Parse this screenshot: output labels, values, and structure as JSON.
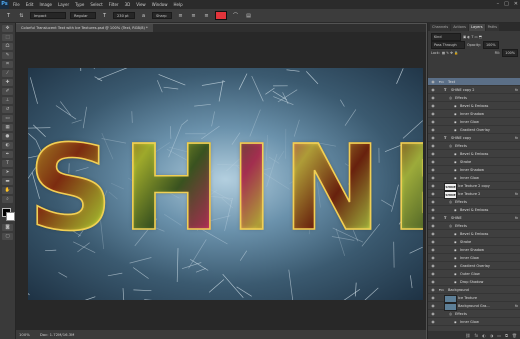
{
  "app": {
    "logo": "Ps"
  },
  "menu": [
    "File",
    "Edit",
    "Image",
    "Layer",
    "Type",
    "Select",
    "Filter",
    "3D",
    "View",
    "Window",
    "Help"
  ],
  "window_controls": [
    "–",
    "□",
    "✕"
  ],
  "options": {
    "font_family": "Impact",
    "font_style": "Regular",
    "font_size": "230 pt",
    "antialias": "Sharp",
    "text_color": "#e2343b"
  },
  "document": {
    "tab_title": "Colorful Translucent Text with Ice Textures.psd @ 100% (Text, RGB/8) *",
    "headline": "SHINE"
  },
  "status": {
    "zoom": "100%",
    "doc_size": "Doc: 1.72M/16.3M"
  },
  "panel": {
    "tabs": [
      "Channels",
      "Actions",
      "Layers",
      "Paths"
    ],
    "active_tab": "Layers",
    "kind_label": "Kind",
    "blend_mode": "Pass Through",
    "opacity_label": "Opacity:",
    "opacity_value": "100%",
    "lock_label": "Lock:",
    "fill_label": "Fill:",
    "fill_value": "100%"
  },
  "layers": [
    {
      "name": "Text",
      "type": "group",
      "indent": 0,
      "selected": true
    },
    {
      "name": "SHINE copy 2",
      "type": "text",
      "indent": 1,
      "fx": true
    },
    {
      "name": "Effects",
      "type": "effects",
      "indent": 2
    },
    {
      "name": "Bevel & Emboss",
      "type": "effect",
      "indent": 3
    },
    {
      "name": "Inner Shadow",
      "type": "effect",
      "indent": 3
    },
    {
      "name": "Inner Glow",
      "type": "effect",
      "indent": 3
    },
    {
      "name": "Gradient Overlay",
      "type": "effect",
      "indent": 3
    },
    {
      "name": "SHINE copy",
      "type": "text",
      "indent": 1,
      "fx": true
    },
    {
      "name": "Effects",
      "type": "effects",
      "indent": 2
    },
    {
      "name": "Bevel & Emboss",
      "type": "effect",
      "indent": 3
    },
    {
      "name": "Stroke",
      "type": "effect",
      "indent": 3
    },
    {
      "name": "Inner Shadow",
      "type": "effect",
      "indent": 3
    },
    {
      "name": "Inner Glow",
      "type": "effect",
      "indent": 3
    },
    {
      "name": "Ice Texture 2 copy",
      "type": "image",
      "indent": 1,
      "thumb": "SHINE"
    },
    {
      "name": "Ice Texture 2",
      "type": "image",
      "indent": 1,
      "thumb": "SHINE",
      "fx": true
    },
    {
      "name": "Effects",
      "type": "effects",
      "indent": 2
    },
    {
      "name": "Bevel & Emboss",
      "type": "effect",
      "indent": 3
    },
    {
      "name": "SHINE",
      "type": "text",
      "indent": 1,
      "fx": true
    },
    {
      "name": "Effects",
      "type": "effects",
      "indent": 2
    },
    {
      "name": "Bevel & Emboss",
      "type": "effect",
      "indent": 3
    },
    {
      "name": "Stroke",
      "type": "effect",
      "indent": 3
    },
    {
      "name": "Inner Shadow",
      "type": "effect",
      "indent": 3
    },
    {
      "name": "Inner Glow",
      "type": "effect",
      "indent": 3
    },
    {
      "name": "Gradient Overlay",
      "type": "effect",
      "indent": 3
    },
    {
      "name": "Outer Glow",
      "type": "effect",
      "indent": 3
    },
    {
      "name": "Drop Shadow",
      "type": "effect",
      "indent": 3
    },
    {
      "name": "Background",
      "type": "group",
      "indent": 0
    },
    {
      "name": "Ice Texture",
      "type": "image",
      "indent": 1,
      "thumb": ""
    },
    {
      "name": "Background Gra...",
      "type": "image",
      "indent": 1,
      "thumb": "",
      "fx": true
    },
    {
      "name": "Effects",
      "type": "effects",
      "indent": 2
    },
    {
      "name": "Inner Glow",
      "type": "effect",
      "indent": 3
    }
  ],
  "layer_footer_icons": [
    "link-icon",
    "fx-icon",
    "mask-icon",
    "adjustment-icon",
    "folder-icon",
    "new-layer-icon",
    "trash-icon"
  ]
}
